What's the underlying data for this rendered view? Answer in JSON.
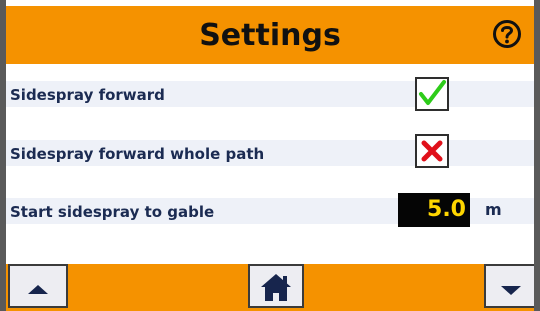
{
  "header": {
    "title": "Settings",
    "help_icon": "question-circle-icon"
  },
  "settings": [
    {
      "label": "Sidespray forward",
      "state": "checked",
      "icon": "green-check-icon"
    },
    {
      "label": "Sidespray forward whole path",
      "state": "unchecked",
      "icon": "red-x-icon"
    },
    {
      "label": "Start sidespray to gable",
      "value": "5.0",
      "unit": "m"
    }
  ],
  "footer": {
    "up_icon": "up-arrow-icon",
    "home_icon": "home-icon",
    "down_icon": "down-arrow-icon"
  },
  "colors": {
    "accent": "#f59200",
    "row_bg": "#eef1f8",
    "label": "#1b2b52",
    "value_bg": "#050505",
    "value_text": "#ffd600",
    "check": "#2ecc1a",
    "cross": "#e0101a"
  }
}
